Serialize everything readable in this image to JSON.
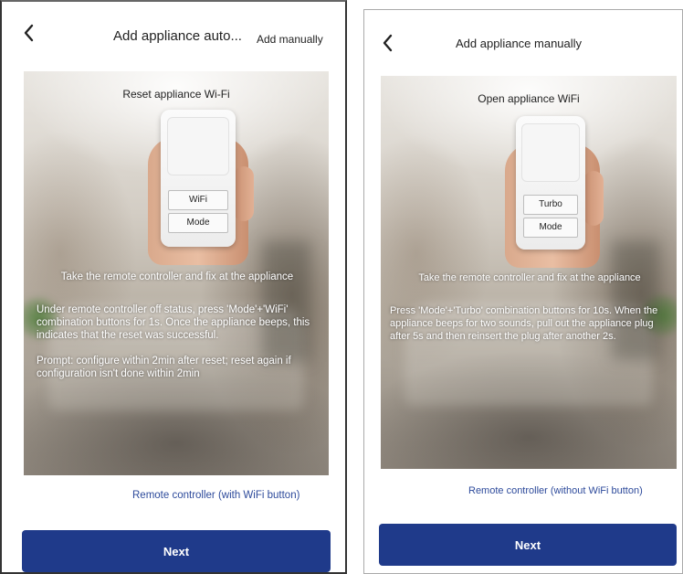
{
  "screens": [
    {
      "title": "Add appliance auto...",
      "add_manually": "Add manually",
      "panel_heading": "Reset appliance Wi-Fi",
      "remote_buttons": [
        "WiFi",
        "Mode"
      ],
      "instructions": [
        "Take the remote controller and fix at the appliance",
        "Under remote controller off status, press 'Mode'+'WiFi' combination buttons for 1s. Once the appliance beeps, this indicates that the reset was successful.",
        "Prompt: configure within 2min after reset; reset again if configuration isn't done within 2min"
      ],
      "remote_type_link": "Remote controller (with WiFi button)",
      "next_label": "Next"
    },
    {
      "title": "Add appliance manually",
      "panel_heading": "Open appliance WiFi",
      "remote_buttons": [
        "Turbo",
        "Mode"
      ],
      "instructions": [
        "Take the remote controller and fix at the appliance",
        "Press 'Mode'+'Turbo' combination buttons for 10s. When the appliance beeps for two sounds, pull out the appliance plug after 5s and then reinsert the plug after another 2s."
      ],
      "remote_type_link": "Remote controller (without WiFi button)",
      "next_label": "Next"
    }
  ],
  "icons": {
    "back": "chevron-left-icon"
  },
  "colors": {
    "primary_button": "#1f3a8a",
    "link": "#2d4a9b"
  }
}
